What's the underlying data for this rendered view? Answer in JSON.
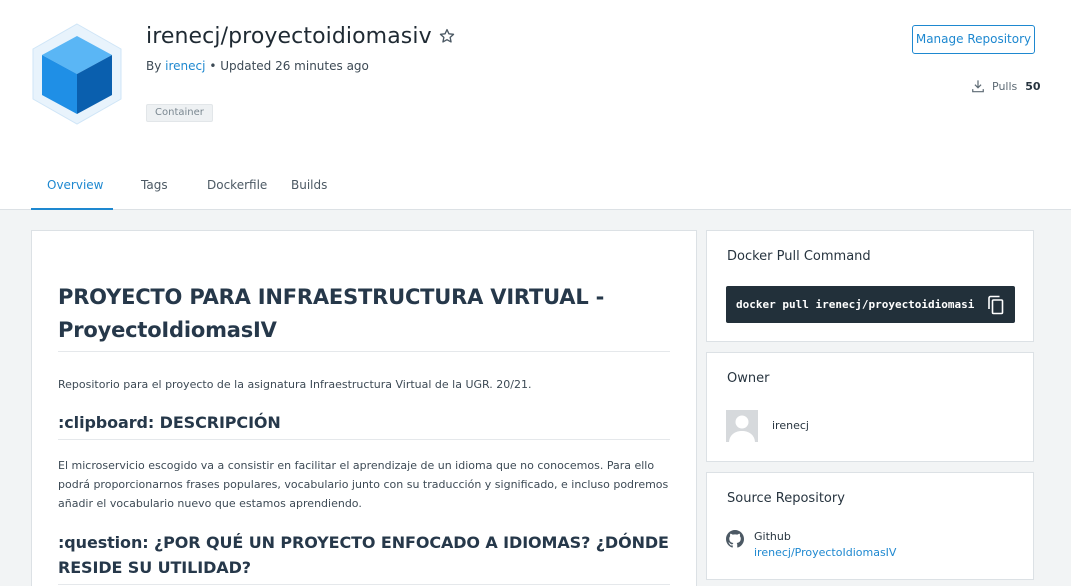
{
  "repo": {
    "name": "irenecj/proyectoidiomasiv",
    "by_label": "By",
    "owner": "irenecj",
    "updated": "• Updated 26 minutes ago",
    "badge": "Container"
  },
  "actions": {
    "manage": "Manage Repository",
    "pulls_label": "Pulls",
    "pulls_count": "50"
  },
  "tabs": [
    {
      "label": "Overview",
      "active": true
    },
    {
      "label": "Tags"
    },
    {
      "label": "Dockerfile"
    },
    {
      "label": "Builds"
    }
  ],
  "readme": {
    "title": "PROYECTO PARA INFRAESTRUCTURA VIRTUAL - ProyectoIdiomasIV",
    "intro": "Repositorio para el proyecto de la asignatura Infraestructura Virtual de la UGR. 20/21.",
    "section1_title": ":clipboard: DESCRIPCIÓN",
    "section1_text": "El microservicio escogido va a consistir en facilitar el aprendizaje de un idioma que no conocemos. Para ello podrá proporcionarnos frases populares, vocabulario junto con su traducción y significado, e incluso podremos añadir el vocabulario nuevo que estamos aprendiendo.",
    "section2_title": ":question: ¿POR QUÉ UN PROYECTO ENFOCADO A IDIOMAS? ¿DÓNDE RESIDE SU UTILIDAD?"
  },
  "pull_command": {
    "title": "Docker Pull Command",
    "command": "docker pull irenecj/proyectoidiomasi"
  },
  "owner_card": {
    "title": "Owner",
    "name": "irenecj"
  },
  "source_card": {
    "title": "Source Repository",
    "provider": "Github",
    "link": "irenecj/ProyectoIdiomasIV"
  },
  "colors": {
    "accent": "#1e88d0",
    "cube_light": "#3aa0f0",
    "cube_dark": "#0b63b0",
    "cmd_bg": "#22303a"
  }
}
